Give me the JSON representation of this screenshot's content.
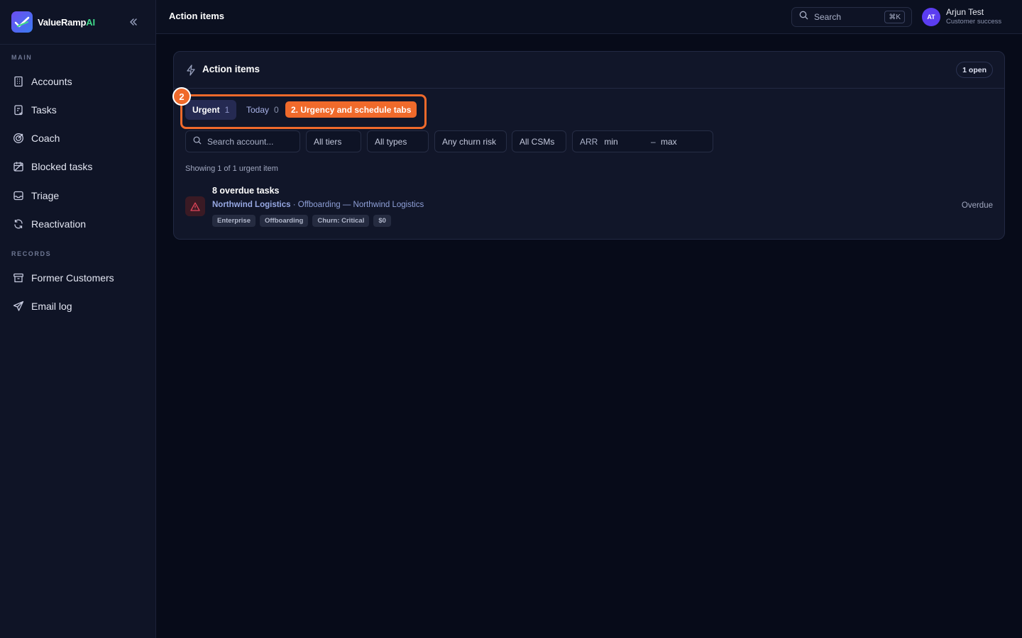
{
  "brand": {
    "name": "ValueRamp",
    "suffix": "AI"
  },
  "sidebar": {
    "sections": [
      {
        "label": "MAIN"
      },
      {
        "label": "RECORDS"
      }
    ],
    "items": [
      {
        "label": "Accounts",
        "icon": "building-icon"
      },
      {
        "label": "Tasks",
        "icon": "clipboard-icon"
      },
      {
        "label": "Coach",
        "icon": "target-icon"
      },
      {
        "label": "Blocked tasks",
        "icon": "calendar-off-icon"
      },
      {
        "label": "Triage",
        "icon": "inbox-icon"
      },
      {
        "label": "Reactivation",
        "icon": "refresh-icon"
      },
      {
        "label": "Former Customers",
        "icon": "archive-icon"
      },
      {
        "label": "Email log",
        "icon": "send-icon"
      }
    ]
  },
  "topbar": {
    "title": "Action items",
    "search_label": "Search",
    "shortcut": "⌘K",
    "user": {
      "initials": "AT",
      "name": "Arjun Test",
      "role": "Customer success"
    }
  },
  "card": {
    "title": "Action items",
    "open_badge": "1 open",
    "tabs": [
      {
        "label": "Urgent",
        "count": "1"
      },
      {
        "label": "Today",
        "count": "0"
      }
    ],
    "annotation": {
      "number": "2",
      "label": "2. Urgency and schedule tabs",
      "color": "#f06a2b"
    },
    "filters": {
      "search_placeholder": "Search account...",
      "tiers": "All tiers",
      "types": "All types",
      "churn": "Any churn risk",
      "csms": "All CSMs",
      "arr_label": "ARR",
      "arr_min": "min",
      "arr_dash": "–",
      "arr_max": "max"
    },
    "showing_text": "Showing 1 of 1 urgent item",
    "items": [
      {
        "title": "8 overdue tasks",
        "account": "Northwind Logistics",
        "detail": " · Offboarding — Northwind Logistics",
        "tags": [
          "Enterprise",
          "Offboarding",
          "Churn: Critical",
          "$0"
        ],
        "status": "Overdue"
      }
    ]
  }
}
